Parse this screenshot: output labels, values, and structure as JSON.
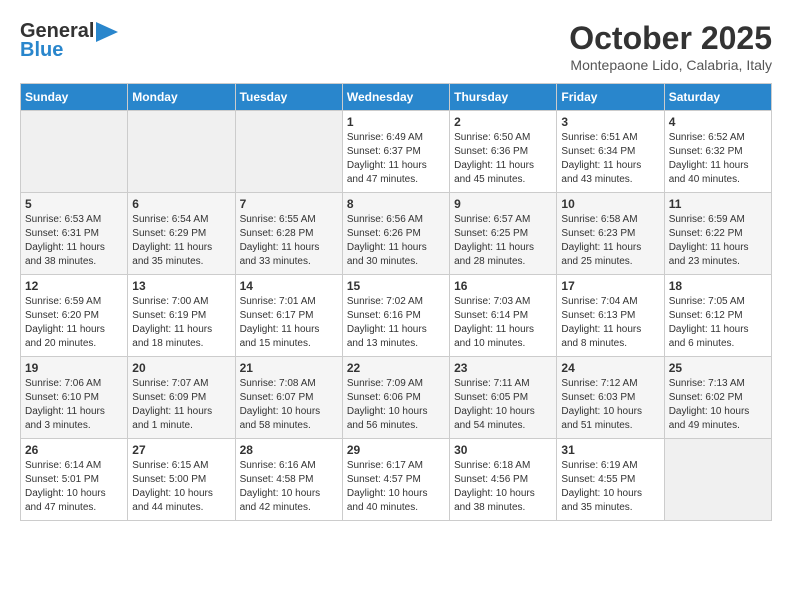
{
  "logo": {
    "line1": "General",
    "line2": "Blue"
  },
  "title": "October 2025",
  "subtitle": "Montepaone Lido, Calabria, Italy",
  "days_of_week": [
    "Sunday",
    "Monday",
    "Tuesday",
    "Wednesday",
    "Thursday",
    "Friday",
    "Saturday"
  ],
  "weeks": [
    [
      {
        "day": "",
        "info": ""
      },
      {
        "day": "",
        "info": ""
      },
      {
        "day": "",
        "info": ""
      },
      {
        "day": "1",
        "info": "Sunrise: 6:49 AM\nSunset: 6:37 PM\nDaylight: 11 hours\nand 47 minutes."
      },
      {
        "day": "2",
        "info": "Sunrise: 6:50 AM\nSunset: 6:36 PM\nDaylight: 11 hours\nand 45 minutes."
      },
      {
        "day": "3",
        "info": "Sunrise: 6:51 AM\nSunset: 6:34 PM\nDaylight: 11 hours\nand 43 minutes."
      },
      {
        "day": "4",
        "info": "Sunrise: 6:52 AM\nSunset: 6:32 PM\nDaylight: 11 hours\nand 40 minutes."
      }
    ],
    [
      {
        "day": "5",
        "info": "Sunrise: 6:53 AM\nSunset: 6:31 PM\nDaylight: 11 hours\nand 38 minutes."
      },
      {
        "day": "6",
        "info": "Sunrise: 6:54 AM\nSunset: 6:29 PM\nDaylight: 11 hours\nand 35 minutes."
      },
      {
        "day": "7",
        "info": "Sunrise: 6:55 AM\nSunset: 6:28 PM\nDaylight: 11 hours\nand 33 minutes."
      },
      {
        "day": "8",
        "info": "Sunrise: 6:56 AM\nSunset: 6:26 PM\nDaylight: 11 hours\nand 30 minutes."
      },
      {
        "day": "9",
        "info": "Sunrise: 6:57 AM\nSunset: 6:25 PM\nDaylight: 11 hours\nand 28 minutes."
      },
      {
        "day": "10",
        "info": "Sunrise: 6:58 AM\nSunset: 6:23 PM\nDaylight: 11 hours\nand 25 minutes."
      },
      {
        "day": "11",
        "info": "Sunrise: 6:59 AM\nSunset: 6:22 PM\nDaylight: 11 hours\nand 23 minutes."
      }
    ],
    [
      {
        "day": "12",
        "info": "Sunrise: 6:59 AM\nSunset: 6:20 PM\nDaylight: 11 hours\nand 20 minutes."
      },
      {
        "day": "13",
        "info": "Sunrise: 7:00 AM\nSunset: 6:19 PM\nDaylight: 11 hours\nand 18 minutes."
      },
      {
        "day": "14",
        "info": "Sunrise: 7:01 AM\nSunset: 6:17 PM\nDaylight: 11 hours\nand 15 minutes."
      },
      {
        "day": "15",
        "info": "Sunrise: 7:02 AM\nSunset: 6:16 PM\nDaylight: 11 hours\nand 13 minutes."
      },
      {
        "day": "16",
        "info": "Sunrise: 7:03 AM\nSunset: 6:14 PM\nDaylight: 11 hours\nand 10 minutes."
      },
      {
        "day": "17",
        "info": "Sunrise: 7:04 AM\nSunset: 6:13 PM\nDaylight: 11 hours\nand 8 minutes."
      },
      {
        "day": "18",
        "info": "Sunrise: 7:05 AM\nSunset: 6:12 PM\nDaylight: 11 hours\nand 6 minutes."
      }
    ],
    [
      {
        "day": "19",
        "info": "Sunrise: 7:06 AM\nSunset: 6:10 PM\nDaylight: 11 hours\nand 3 minutes."
      },
      {
        "day": "20",
        "info": "Sunrise: 7:07 AM\nSunset: 6:09 PM\nDaylight: 11 hours\nand 1 minute."
      },
      {
        "day": "21",
        "info": "Sunrise: 7:08 AM\nSunset: 6:07 PM\nDaylight: 10 hours\nand 58 minutes."
      },
      {
        "day": "22",
        "info": "Sunrise: 7:09 AM\nSunset: 6:06 PM\nDaylight: 10 hours\nand 56 minutes."
      },
      {
        "day": "23",
        "info": "Sunrise: 7:11 AM\nSunset: 6:05 PM\nDaylight: 10 hours\nand 54 minutes."
      },
      {
        "day": "24",
        "info": "Sunrise: 7:12 AM\nSunset: 6:03 PM\nDaylight: 10 hours\nand 51 minutes."
      },
      {
        "day": "25",
        "info": "Sunrise: 7:13 AM\nSunset: 6:02 PM\nDaylight: 10 hours\nand 49 minutes."
      }
    ],
    [
      {
        "day": "26",
        "info": "Sunrise: 6:14 AM\nSunset: 5:01 PM\nDaylight: 10 hours\nand 47 minutes."
      },
      {
        "day": "27",
        "info": "Sunrise: 6:15 AM\nSunset: 5:00 PM\nDaylight: 10 hours\nand 44 minutes."
      },
      {
        "day": "28",
        "info": "Sunrise: 6:16 AM\nSunset: 4:58 PM\nDaylight: 10 hours\nand 42 minutes."
      },
      {
        "day": "29",
        "info": "Sunrise: 6:17 AM\nSunset: 4:57 PM\nDaylight: 10 hours\nand 40 minutes."
      },
      {
        "day": "30",
        "info": "Sunrise: 6:18 AM\nSunset: 4:56 PM\nDaylight: 10 hours\nand 38 minutes."
      },
      {
        "day": "31",
        "info": "Sunrise: 6:19 AM\nSunset: 4:55 PM\nDaylight: 10 hours\nand 35 minutes."
      },
      {
        "day": "",
        "info": ""
      }
    ]
  ]
}
